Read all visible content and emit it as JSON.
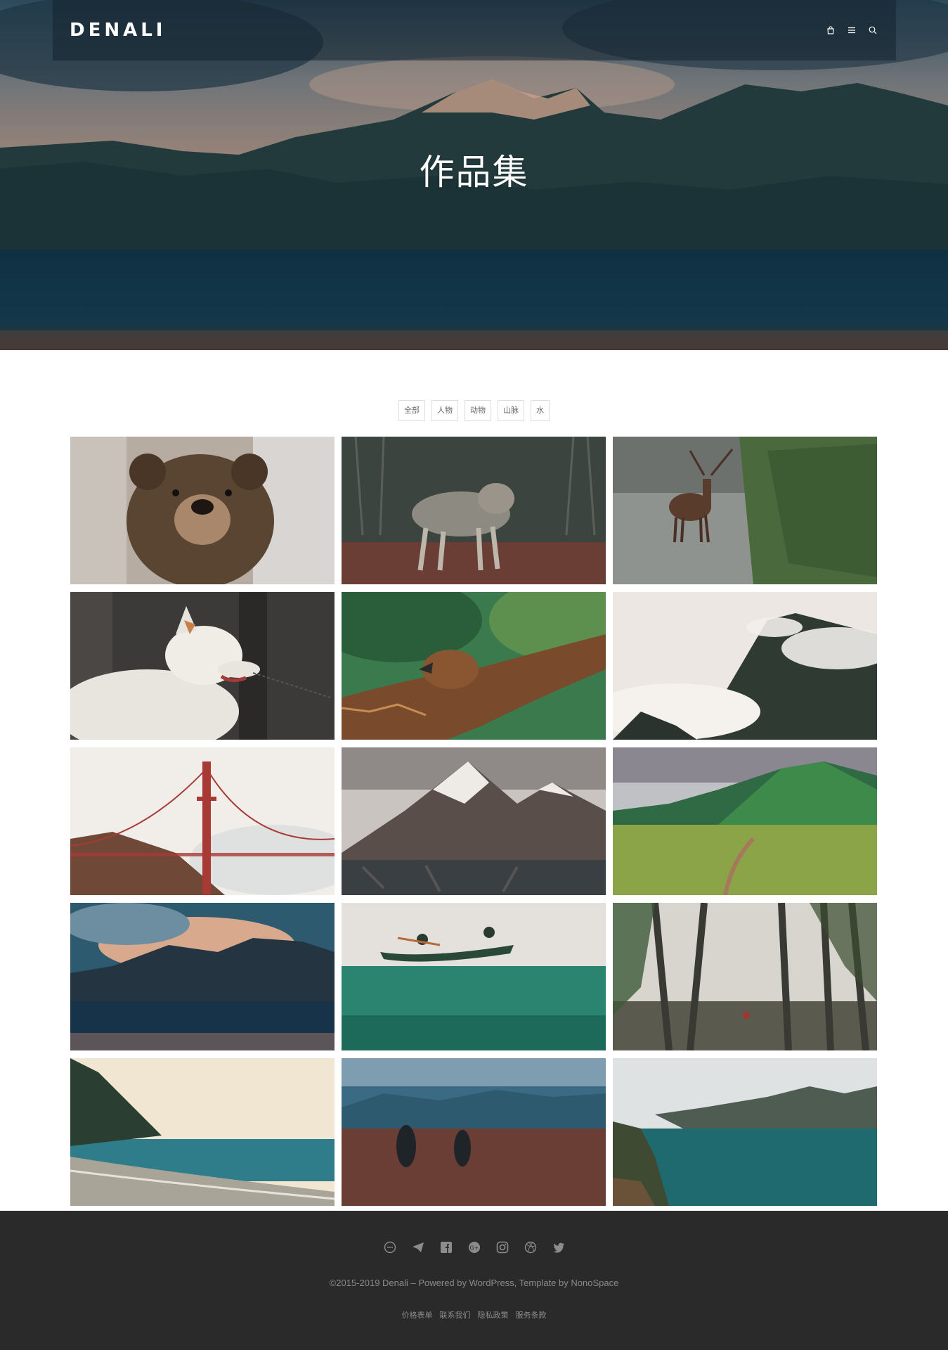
{
  "header": {
    "logo": "DENALI",
    "icons": [
      "bag-icon",
      "menu-icon",
      "search-icon"
    ]
  },
  "hero": {
    "title": "作品集"
  },
  "filters": [
    {
      "label": "全部"
    },
    {
      "label": "人物"
    },
    {
      "label": "动物"
    },
    {
      "label": "山脉"
    },
    {
      "label": "水"
    }
  ],
  "gallery": [
    {
      "subject": "bear"
    },
    {
      "subject": "wolf"
    },
    {
      "subject": "deer"
    },
    {
      "subject": "white-dog"
    },
    {
      "subject": "eagle"
    },
    {
      "subject": "misty-mountain"
    },
    {
      "subject": "golden-gate-bridge"
    },
    {
      "subject": "snowy-mountain-lake"
    },
    {
      "subject": "green-hills"
    },
    {
      "subject": "mountain-lake"
    },
    {
      "subject": "canoe"
    },
    {
      "subject": "foggy-forest"
    },
    {
      "subject": "beach"
    },
    {
      "subject": "field-people"
    },
    {
      "subject": "fjord"
    }
  ],
  "footer": {
    "socials": [
      "chat-icon",
      "telegram-icon",
      "facebook-icon",
      "google-plus-icon",
      "instagram-icon",
      "dribbble-icon",
      "twitter-icon"
    ],
    "copyright": "©2015-2019 Denali – Powered by WordPress, Template by NonoSpace",
    "links": [
      {
        "label": "价格表单"
      },
      {
        "label": "联系我们"
      },
      {
        "label": "隐私政策"
      },
      {
        "label": "服务条款"
      }
    ]
  },
  "colors": {
    "footer_bg": "#2a2a2a",
    "header_overlay": "#14222e",
    "filter_border": "#dedede"
  }
}
